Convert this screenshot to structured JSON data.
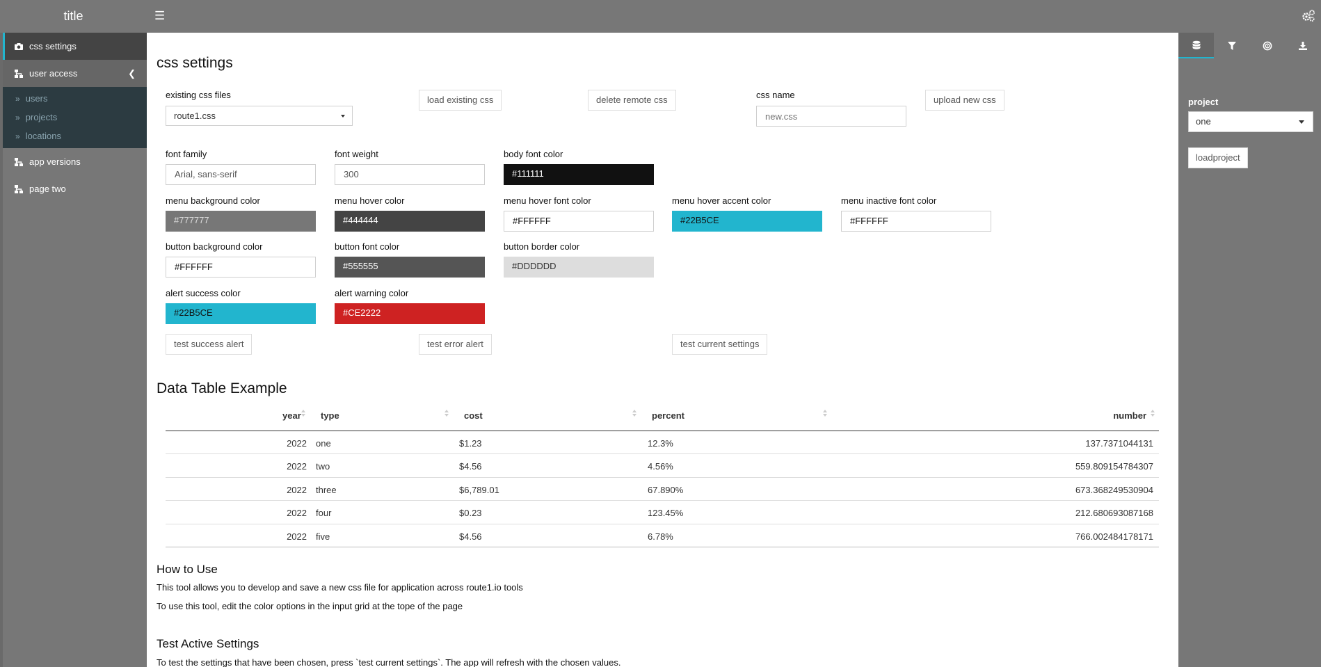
{
  "header": {
    "title": "title",
    "menu_icon": "hamburger-icon",
    "settings_icon": "gears-icon"
  },
  "sidebar": {
    "items": [
      {
        "label": "css settings",
        "icon": "camera-icon"
      },
      {
        "label": "user access",
        "icon": "sitemap-icon",
        "expanded": true
      },
      {
        "label": "app versions",
        "icon": "sitemap-icon"
      },
      {
        "label": "page two",
        "icon": "sitemap-icon"
      }
    ],
    "sub_items": [
      "users",
      "projects",
      "locations"
    ]
  },
  "main": {
    "title": "css settings",
    "files": {
      "existing_label": "existing css files",
      "existing_value": "route1.css",
      "load_button": "load existing css",
      "delete_button": "delete remote css",
      "name_label": "css name",
      "name_placeholder": "new.css",
      "upload_button": "upload new css"
    },
    "fields": {
      "font_family": {
        "label": "font family",
        "value": "Arial, sans-serif"
      },
      "font_weight": {
        "label": "font weight",
        "value": "300"
      },
      "body_font_color": {
        "label": "body font color",
        "value": "#111111"
      },
      "menu_background_color": {
        "label": "menu background color",
        "value": "#777777"
      },
      "menu_hover_color": {
        "label": "menu hover color",
        "value": "#444444"
      },
      "menu_hover_font_color": {
        "label": "menu hover font color",
        "value": "#FFFFFF"
      },
      "menu_hover_accent_color": {
        "label": "menu hover accent color",
        "value": "#22B5CE"
      },
      "menu_inactive_font_color": {
        "label": "menu inactive font color",
        "value": "#FFFFFF"
      },
      "button_background_color": {
        "label": "button background color",
        "value": "#FFFFFF"
      },
      "button_font_color": {
        "label": "button font color",
        "value": "#555555"
      },
      "button_border_color": {
        "label": "button border color",
        "value": "#DDDDDD"
      },
      "alert_success_color": {
        "label": "alert success color",
        "value": "#22B5CE"
      },
      "alert_warning_color": {
        "label": "alert warning color",
        "value": "#CE2222"
      }
    },
    "buttons": {
      "test_success": "test success alert",
      "test_error": "test error alert",
      "test_current": "test current settings"
    },
    "table": {
      "title": "Data Table Example",
      "columns": [
        "year",
        "type",
        "cost",
        "percent",
        "number"
      ],
      "rows": [
        [
          "2022",
          "one",
          "$1.23",
          "12.3%",
          "137.7371044131"
        ],
        [
          "2022",
          "two",
          "$4.56",
          "4.56%",
          "559.809154784307"
        ],
        [
          "2022",
          "three",
          "$6,789.01",
          "67.890%",
          "673.368249530904"
        ],
        [
          "2022",
          "four",
          "$0.23",
          "123.45%",
          "212.680693087168"
        ],
        [
          "2022",
          "five",
          "$4.56",
          "6.78%",
          "766.002484178171"
        ]
      ]
    },
    "how_to": {
      "title": "How to Use",
      "line1": "This tool allows you to develop and save a new css file for application across route1.io tools",
      "line2": "To use this tool, edit the color options in the input grid at the tope of the page"
    },
    "test_active": {
      "title": "Test Active Settings",
      "line1": "To test the settings that have been chosen, press `test current settings`. The app will refresh with the chosen values."
    }
  },
  "right_sidebar": {
    "tabs": [
      "database-icon",
      "filter-icon",
      "bullseye-icon",
      "download-icon"
    ],
    "project_label": "project",
    "project_value": "one",
    "load_button": "loadproject"
  },
  "colors": {
    "accent": "#22B5CE",
    "menu_bg": "#777777",
    "hover": "#444444",
    "warning": "#CE2222"
  }
}
